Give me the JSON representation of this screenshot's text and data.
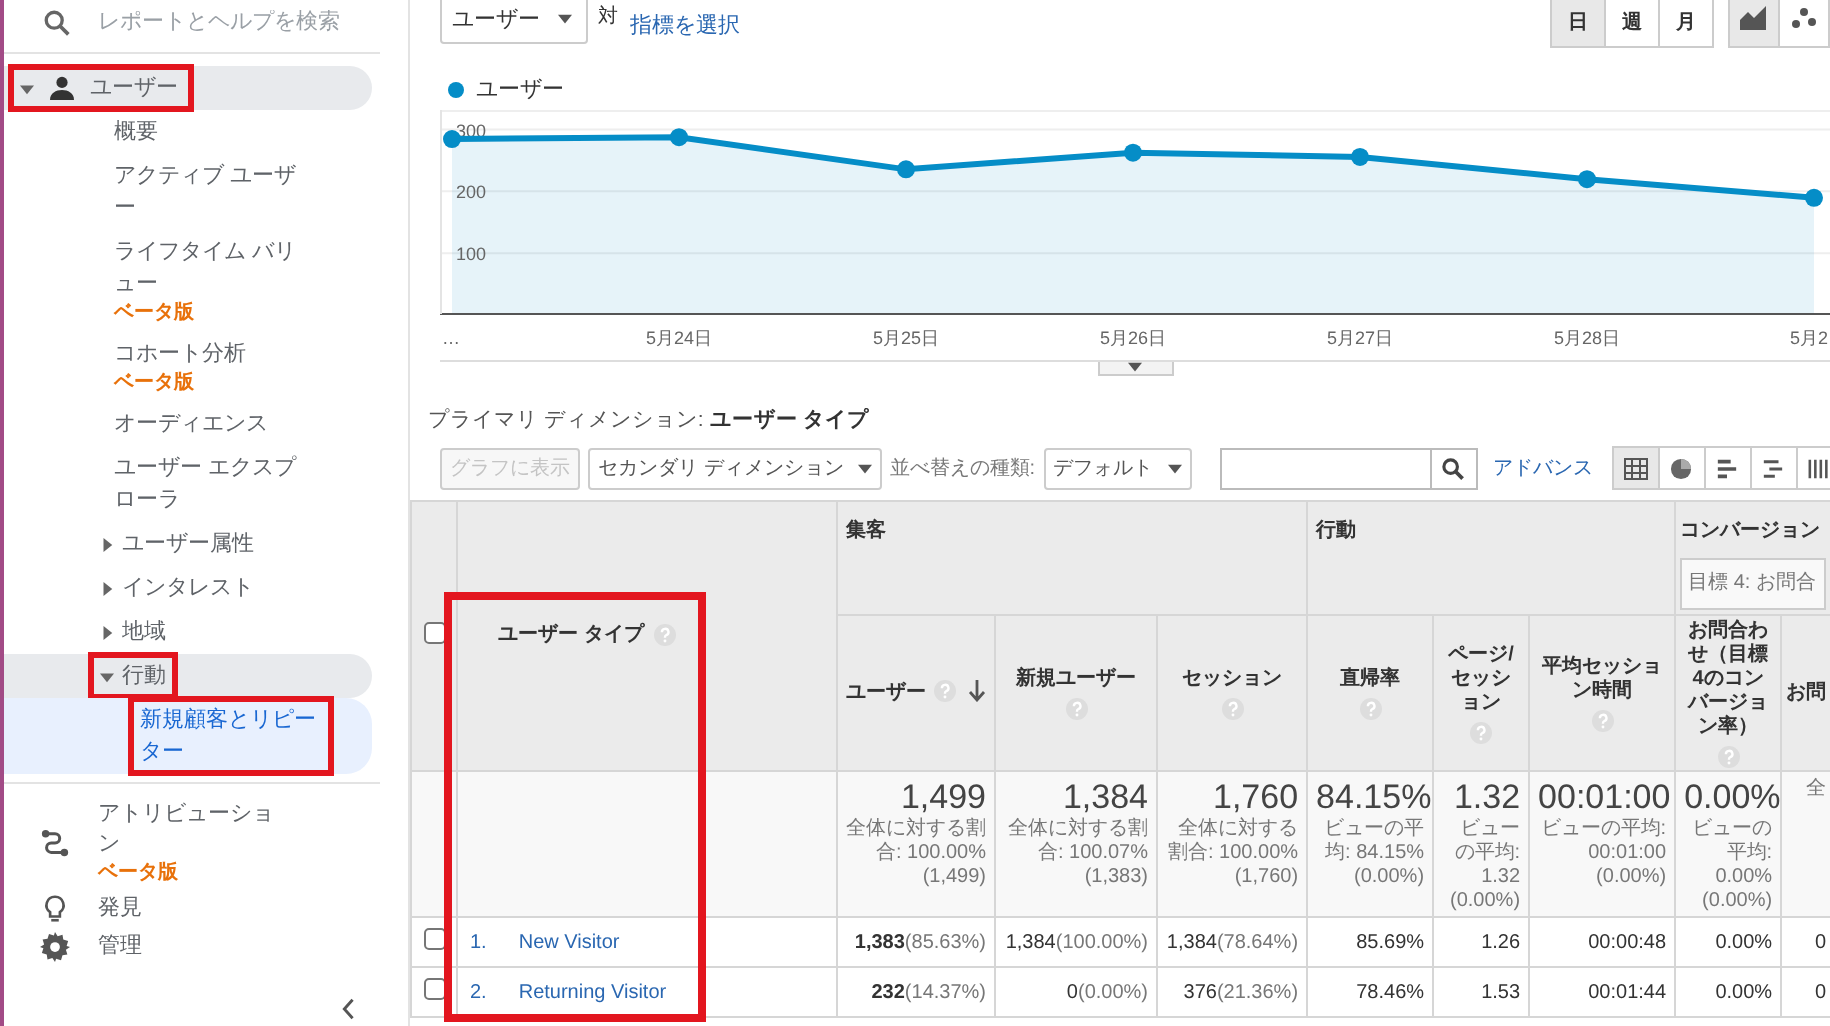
{
  "sidebar": {
    "search": {
      "placeholder": "レポートとヘルプを検索"
    },
    "sections": [
      {
        "label": "ユーザー",
        "expanded": true,
        "annotated": true,
        "children": [
          {
            "label": "概要",
            "selected": false,
            "annotated": false
          },
          {
            "label": "アクティブ ユーザー",
            "selected": false,
            "annotated": false
          },
          {
            "label": "ライフタイム バリュー",
            "badge": "ベータ版",
            "selected": false,
            "annotated": false
          },
          {
            "label": "コホート分析",
            "badge": "ベータ版",
            "selected": false,
            "annotated": false
          },
          {
            "label": "オーディエンス",
            "selected": false,
            "annotated": false
          },
          {
            "label": "ユーザー エクスプローラ",
            "selected": false,
            "annotated": false
          },
          {
            "label": "ユーザー属性",
            "expanded": false,
            "annotated": false
          },
          {
            "label": "インタレスト",
            "expanded": false,
            "annotated": false
          },
          {
            "label": "地域",
            "expanded": false,
            "annotated": false
          },
          {
            "label": "行動",
            "expanded": true,
            "annotated": true,
            "children": [
              {
                "label": "新規顧客とリピーター",
                "selected": true,
                "annotated": true
              }
            ]
          }
        ]
      }
    ],
    "footer_items": [
      {
        "label": "アトリビューション",
        "badge": "ベータ版"
      },
      {
        "label": "発見"
      },
      {
        "label": "管理"
      }
    ]
  },
  "chart_controls": {
    "metric": "ユーザー",
    "versus": "対",
    "metric_picker": "指標を選択",
    "periods": [
      {
        "label": "日",
        "selected": true
      },
      {
        "label": "週",
        "selected": false
      },
      {
        "label": "月",
        "selected": false
      }
    ],
    "chart_types": [
      {
        "selected": true
      },
      {
        "selected": false
      }
    ]
  },
  "chart": {
    "chart_data": {
      "type": "area",
      "grid": true,
      "categories": [
        "…",
        "5月24日",
        "5月25日",
        "5月26日",
        "5月27日",
        "5月28日",
        "5月2"
      ],
      "series": [
        {
          "name": "ユーザー",
          "color": "#058dc7",
          "marker": "circle",
          "values": [
            283,
            286,
            234,
            261,
            254,
            218,
            188
          ]
        }
      ],
      "ylim": [
        0,
        330
      ],
      "yticks": [
        100,
        200,
        300
      ]
    }
  },
  "primary_dimension": {
    "label": "プライマリ ディメンション:",
    "value": "ユーザー タイプ"
  },
  "toolbar": {
    "plot_button": {
      "label": "グラフに表示",
      "disabled": true
    },
    "secondary_dimension": "セカンダリ ディメンション",
    "sort_label": "並べ替えの種類:",
    "sort_type": "デフォルト",
    "advanced": "アドバンス",
    "views": [
      {
        "selected": true
      },
      {
        "selected": false
      },
      {
        "selected": false
      },
      {
        "selected": false
      },
      {
        "selected": false
      }
    ]
  },
  "table": {
    "header_checkbox": {
      "checked": false
    },
    "dimension": {
      "label": "ユーザー タイプ",
      "help": true,
      "annotated": true
    },
    "groups": [
      {
        "label": "集客",
        "columns": [
          {
            "label": "ユーザー",
            "help": true,
            "sorted": true
          },
          {
            "label": "新規ユーザー",
            "help": true,
            "sorted": false
          },
          {
            "label": "セッション",
            "help": true,
            "sorted": false
          }
        ]
      },
      {
        "label": "行動",
        "columns": [
          {
            "label": "直帰率",
            "help": true,
            "sorted": false
          },
          {
            "label": "ページ/セッション",
            "help": true,
            "sorted": false
          },
          {
            "label": "平均セッション時間",
            "help": true,
            "sorted": false
          }
        ]
      },
      {
        "label": "コンバージョン",
        "goal_select": "目標 4: お問合",
        "columns": [
          {
            "label": "お問合わせ（目標4のコンバージョン率）",
            "help": true,
            "sorted": false
          },
          {
            "label": "お問",
            "help": false,
            "sorted": false
          }
        ]
      }
    ],
    "totals": [
      {
        "value": "1,499",
        "note": "全体に対する割合: 100.00% (1,499)"
      },
      {
        "value": "1,384",
        "note": "全体に対する割合: 100.07% (1,383)"
      },
      {
        "value": "1,760",
        "note": "全体に対する割合: 100.00% (1,760)"
      },
      {
        "value": "84.15%",
        "note": "ビューの平均: 84.15% (0.00%)"
      },
      {
        "value": "1.32",
        "note": "ビューの平均: 1.32 (0.00%)"
      },
      {
        "value": "00:01:00",
        "note": "ビューの平均: 00:01:00 (0.00%)"
      },
      {
        "value": "0.00%",
        "note": "ビューの平均: 0.00% (0.00%)"
      },
      {
        "note": "全"
      }
    ],
    "rows": [
      {
        "index": "1.",
        "label": "New Visitor",
        "checked": false,
        "cells": [
          {
            "value": "1,383",
            "share": "(85.63%)"
          },
          {
            "value": "1,384",
            "share": "(100.00%)"
          },
          {
            "value": "1,384",
            "share": "(78.64%)"
          },
          {
            "value": "85.69%"
          },
          {
            "value": "1.26"
          },
          {
            "value": "00:00:48"
          },
          {
            "value": "0.00%"
          },
          {
            "value": "0"
          }
        ]
      },
      {
        "index": "2.",
        "label": "Returning Visitor",
        "checked": false,
        "cells": [
          {
            "value": "232",
            "share": "(14.37%)"
          },
          {
            "value": "0",
            "share": "(0.00%)"
          },
          {
            "value": "376",
            "share": "(21.36%)"
          },
          {
            "value": "78.46%"
          },
          {
            "value": "1.53"
          },
          {
            "value": "00:01:44"
          },
          {
            "value": "0.00%"
          },
          {
            "value": "0"
          }
        ]
      }
    ]
  }
}
